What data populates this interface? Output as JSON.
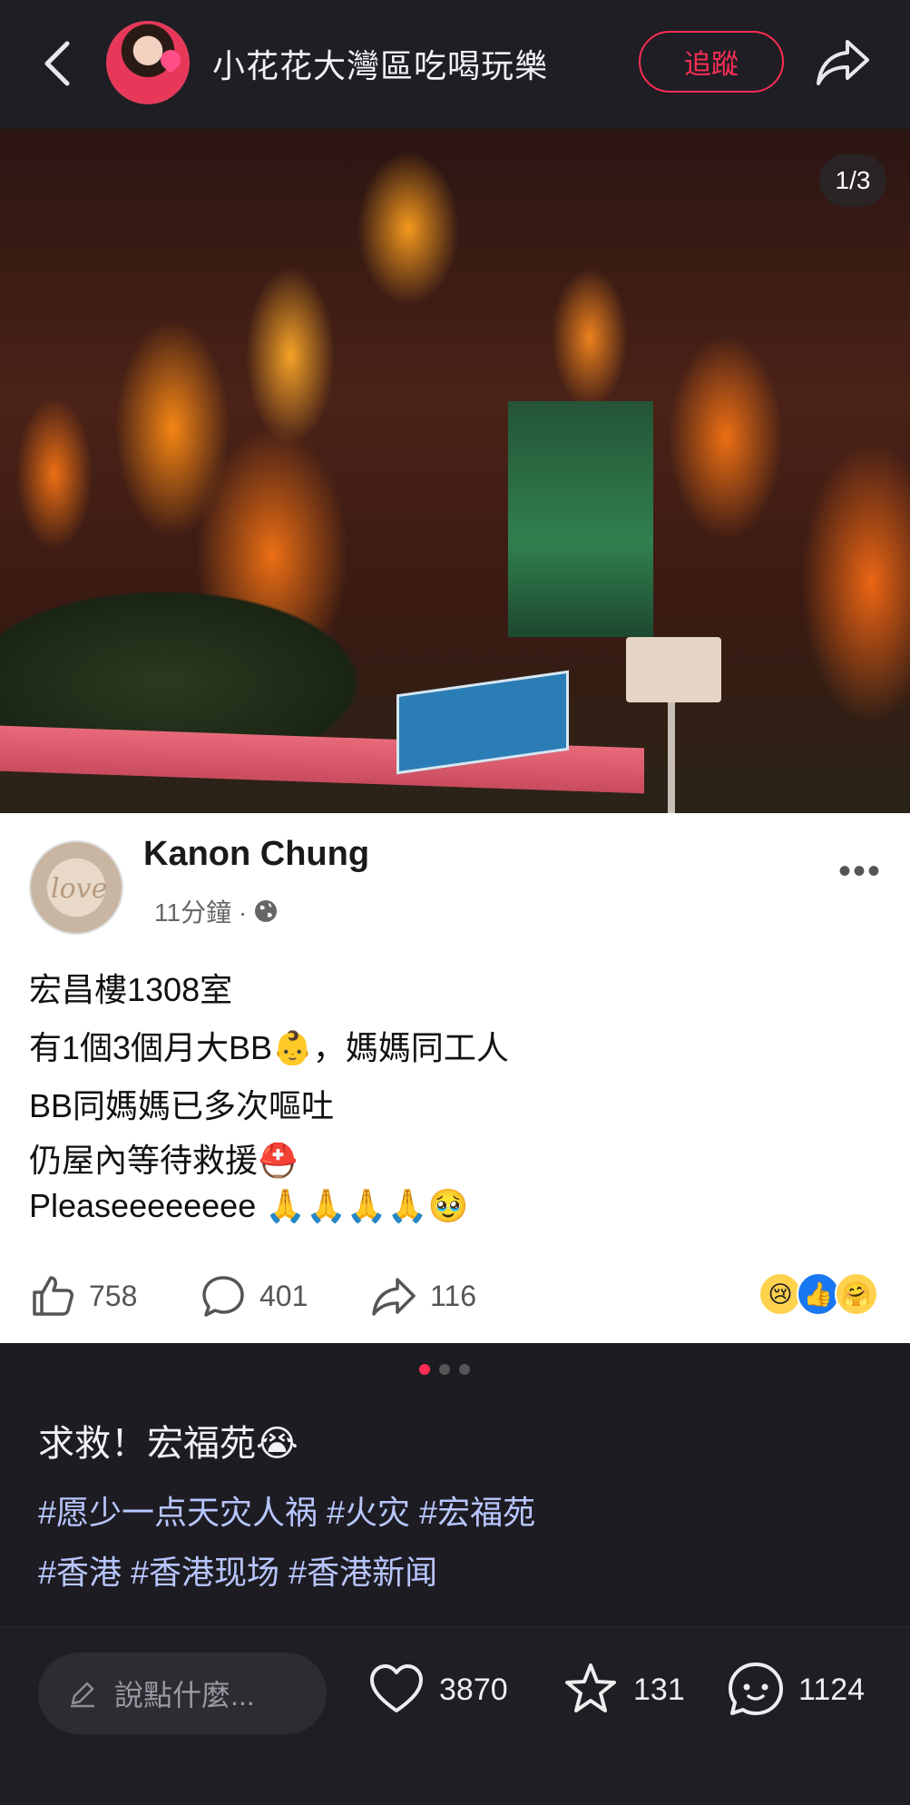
{
  "header": {
    "author": "小花花大灣區吃喝玩樂",
    "follow_label": "追蹤"
  },
  "photo": {
    "counter": "1/3"
  },
  "fb_post": {
    "name": "Kanon Chung",
    "time": "11分鐘 ·",
    "lines": [
      "宏昌樓1308室",
      "有1個3個月大BB👶，媽媽同工人",
      "BB同媽媽已多次嘔吐",
      "仍屋內等待救援⛑️",
      "Pleaseeeeeeee 🙏🙏🙏🙏🥹"
    ],
    "likes": "758",
    "comments": "401",
    "shares": "116",
    "reactions": [
      "😢",
      "👍",
      "🤗"
    ]
  },
  "carousel": {
    "total": 3,
    "active": 1
  },
  "caption": {
    "title": "求救！宏福苑😭",
    "tags_line1": "#愿少一点天灾人祸 #火灾 #宏福苑",
    "tags_line2": "#香港 #香港现场 #香港新闻"
  },
  "bottom_bar": {
    "comment_placeholder": "說點什麼...",
    "like_count": "3870",
    "collect_count": "131",
    "comment_count": "1124"
  },
  "colors": {
    "accent": "#ff2d55",
    "hashtag": "#b8c6ff",
    "background": "#1d1c22"
  }
}
